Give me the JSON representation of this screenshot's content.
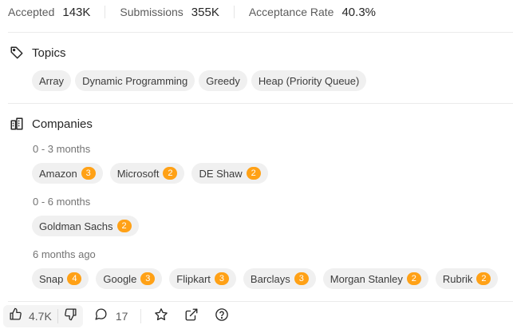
{
  "stats": [
    {
      "label": "Accepted",
      "value": "143K"
    },
    {
      "label": "Submissions",
      "value": "355K"
    },
    {
      "label": "Acceptance Rate",
      "value": "40.3%"
    }
  ],
  "topics": {
    "title": "Topics",
    "icon": "tag-icon",
    "tags": [
      "Array",
      "Dynamic Programming",
      "Greedy",
      "Heap (Priority Queue)"
    ]
  },
  "companies": {
    "title": "Companies",
    "icon": "building-icon",
    "groups": [
      {
        "period": "0 - 3 months",
        "items": [
          {
            "name": "Amazon",
            "count": "3"
          },
          {
            "name": "Microsoft",
            "count": "2"
          },
          {
            "name": "DE Shaw",
            "count": "2"
          }
        ]
      },
      {
        "period": "0 - 6 months",
        "items": [
          {
            "name": "Goldman Sachs",
            "count": "2"
          }
        ]
      },
      {
        "period": "6 months ago",
        "items": [
          {
            "name": "Snap",
            "count": "4"
          },
          {
            "name": "Google",
            "count": "3"
          },
          {
            "name": "Flipkart",
            "count": "3"
          },
          {
            "name": "Barclays",
            "count": "3"
          },
          {
            "name": "Morgan Stanley",
            "count": "2"
          },
          {
            "name": "Rubrik",
            "count": "2"
          }
        ]
      }
    ]
  },
  "bottom_bar": {
    "likes": "4.7K",
    "comments": "17",
    "icons": [
      "thumbs-up-icon",
      "thumbs-down-icon",
      "comment-icon",
      "star-icon",
      "share-icon",
      "help-icon"
    ]
  },
  "colors": {
    "badge": "#ffa116",
    "chip_bg": "#f0f0f0"
  }
}
